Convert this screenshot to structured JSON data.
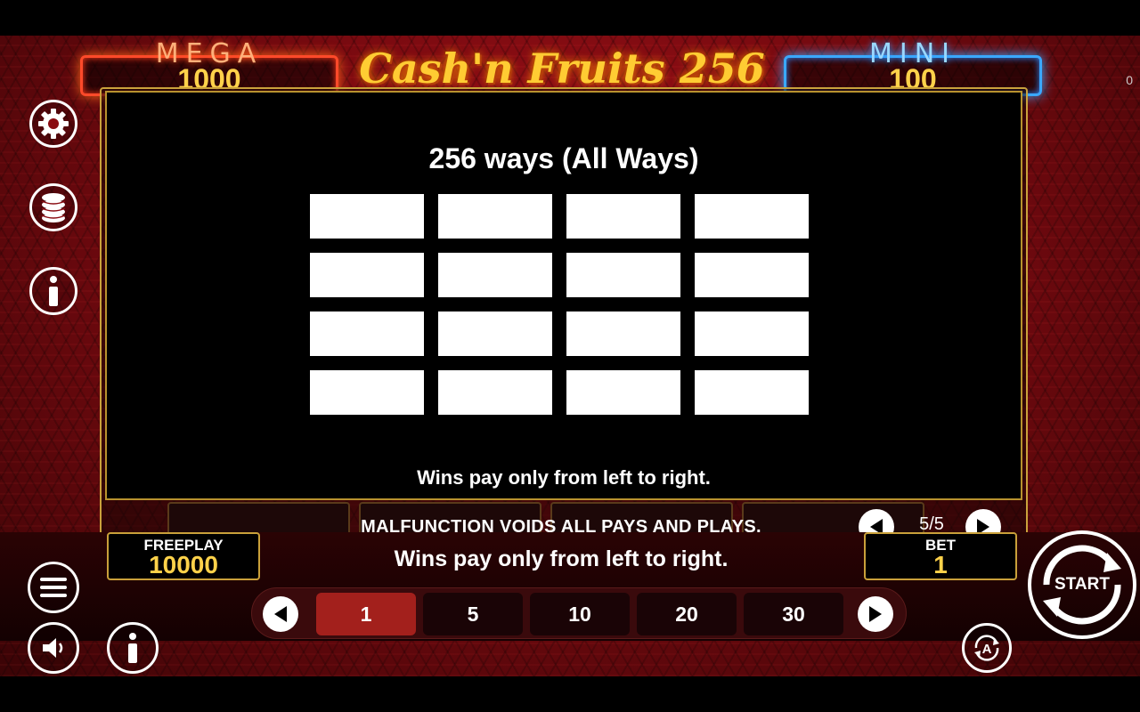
{
  "corner_counter": "0",
  "jackpots": {
    "mega": {
      "label": "MEGA",
      "value": "1000"
    },
    "mini": {
      "label": "MINI",
      "value": "100"
    }
  },
  "game_title": "Cash'n Fruits 256",
  "info_page": {
    "title": "256 ways (All Ways)",
    "grid_rows": 4,
    "grid_cols": 4,
    "note": "Wins pay only from left to right."
  },
  "disclaimer": "MALFUNCTION VOIDS ALL PAYS AND PLAYS.",
  "pagination": {
    "indicator": "5/5"
  },
  "left_menu": {
    "icons": [
      "settings-icon",
      "coins-icon",
      "info-icon"
    ]
  },
  "freeplay": {
    "label": "FREEPLAY",
    "value": "10000"
  },
  "message": "Wins pay only from left to right.",
  "bet": {
    "label": "BET",
    "value": "1"
  },
  "bet_options": [
    {
      "label": "1",
      "selected": true
    },
    {
      "label": "5",
      "selected": false
    },
    {
      "label": "10",
      "selected": false
    },
    {
      "label": "20",
      "selected": false
    },
    {
      "label": "30",
      "selected": false
    }
  ],
  "start_button": {
    "label": "START"
  },
  "colors": {
    "background_red": "#b0141c",
    "gold_border": "#caa23c",
    "value_yellow": "#ffd24a",
    "mega_glow": "#ff4a2a",
    "mini_glow": "#3aa8ff",
    "active_bet": "#a3201c"
  }
}
